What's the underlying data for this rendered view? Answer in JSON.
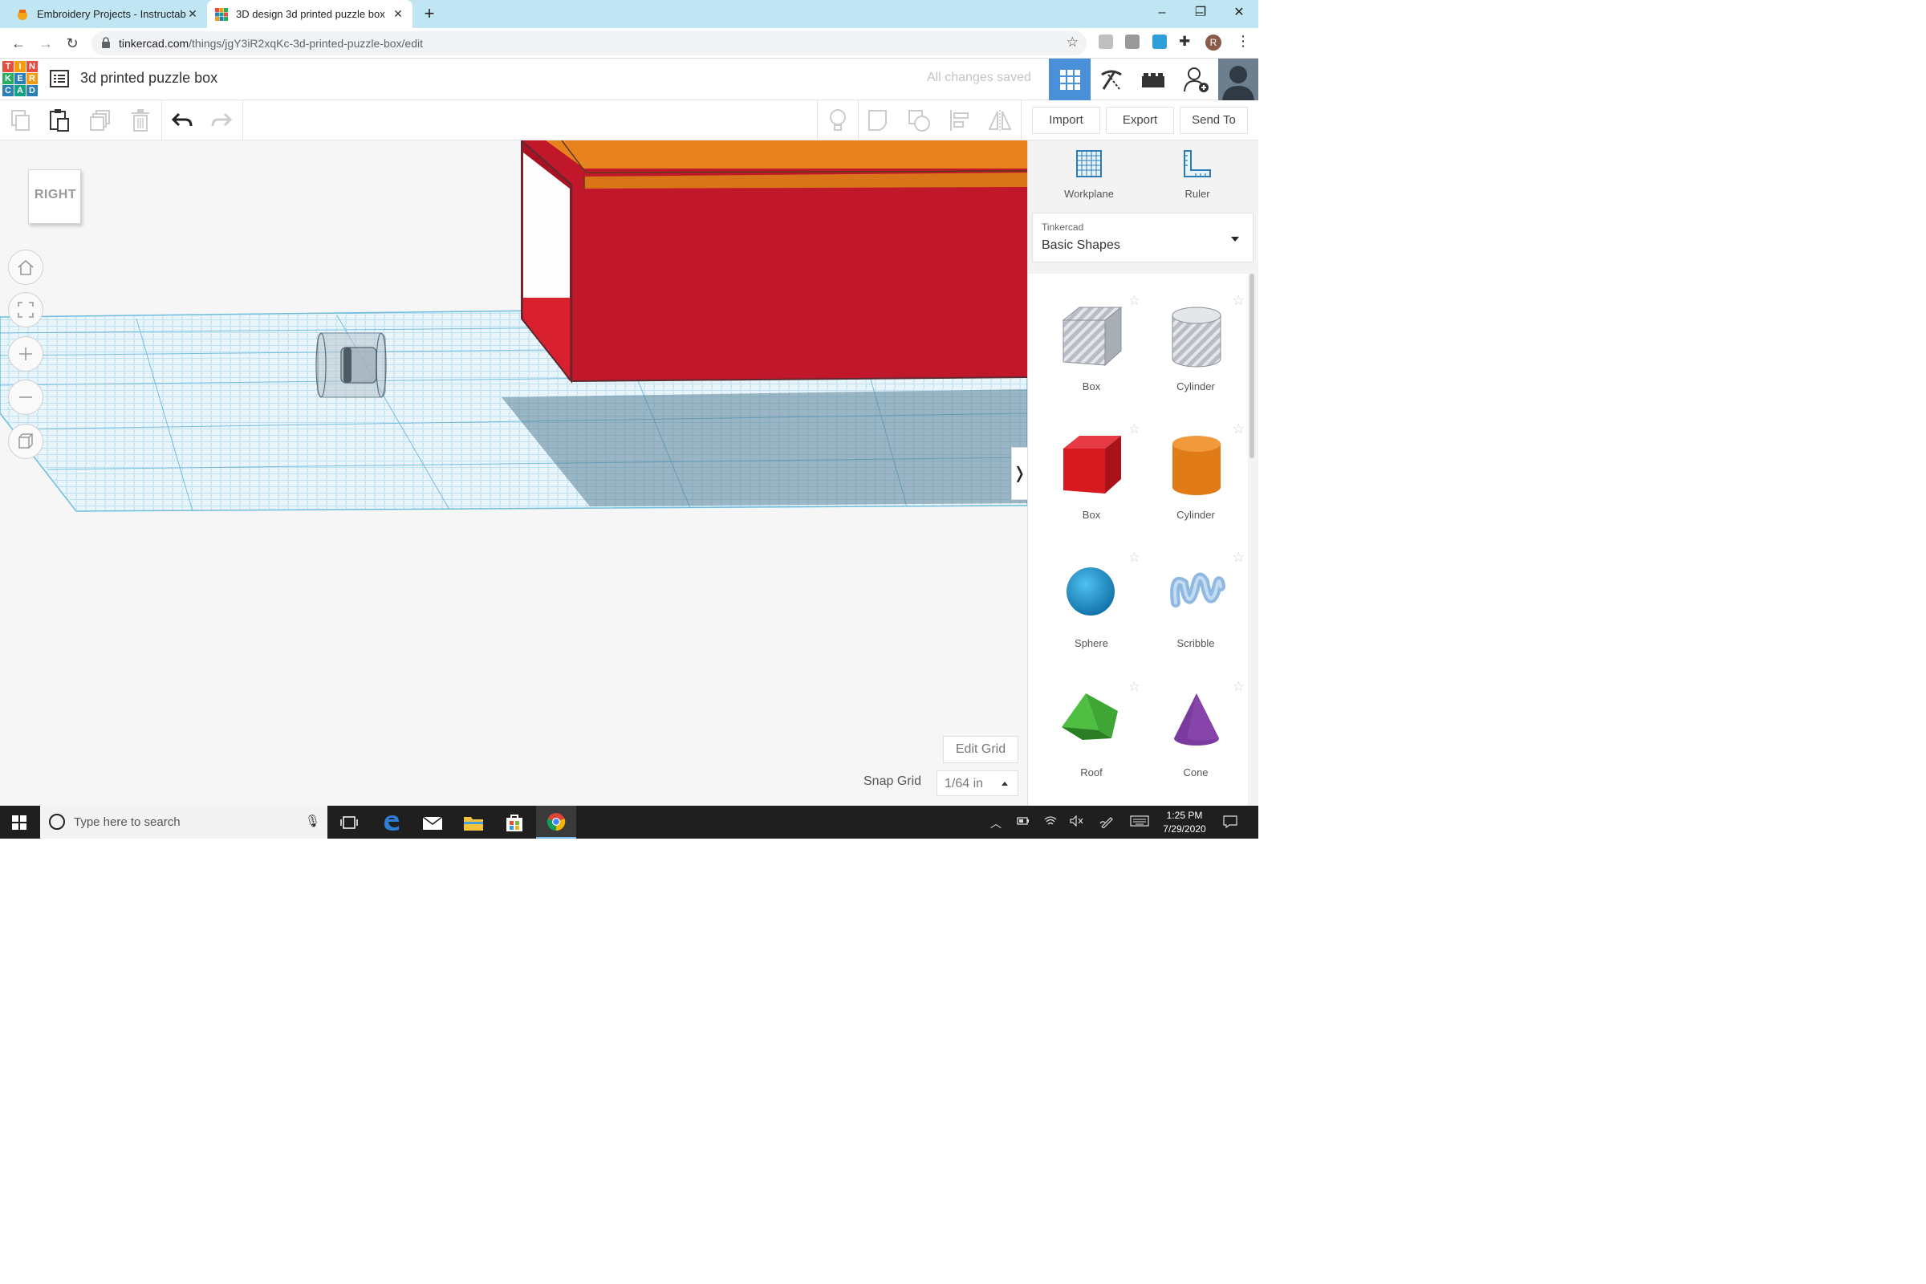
{
  "browser": {
    "tabs": [
      {
        "title": "Embroidery Projects - Instructabl",
        "active": false
      },
      {
        "title": "3D design 3d printed puzzle box",
        "active": true
      }
    ],
    "url_host": "tinkercad.com",
    "url_path": "/things/jgY3iR2xqKc-3d-printed-puzzle-box/edit",
    "profile_initial": "R"
  },
  "app": {
    "logo_letters": [
      "T",
      "I",
      "N",
      "K",
      "E",
      "R",
      "C",
      "A",
      "D"
    ],
    "design_title": "3d printed puzzle box",
    "save_status": "All changes saved"
  },
  "toolbar": {
    "import_label": "Import",
    "export_label": "Export",
    "send_to_label": "Send To"
  },
  "viewport": {
    "viewcube_face": "RIGHT",
    "edit_grid_label": "Edit Grid",
    "snap_grid_label": "Snap Grid",
    "snap_grid_value": "1/64 in"
  },
  "panel": {
    "tools": [
      {
        "label": "Workplane",
        "icon": "workplane-icon"
      },
      {
        "label": "Ruler",
        "icon": "ruler-icon"
      }
    ],
    "library_provider": "Tinkercad",
    "library_name": "Basic Shapes",
    "shapes": [
      {
        "label": "Box",
        "kind": "box-hole",
        "color": "#b8bcc4"
      },
      {
        "label": "Cylinder",
        "kind": "cylinder-hole",
        "color": "#b8bcc4"
      },
      {
        "label": "Box",
        "kind": "box",
        "color": "#d71920"
      },
      {
        "label": "Cylinder",
        "kind": "cylinder",
        "color": "#e07b18"
      },
      {
        "label": "Sphere",
        "kind": "sphere",
        "color": "#1a8ec9"
      },
      {
        "label": "Scribble",
        "kind": "scribble",
        "color": "#8fb9e0"
      },
      {
        "label": "Roof",
        "kind": "roof",
        "color": "#3fa535"
      },
      {
        "label": "Cone",
        "kind": "cone",
        "color": "#7b3a9e"
      }
    ]
  },
  "taskbar": {
    "search_placeholder": "Type here to search",
    "time": "1:25 PM",
    "date": "7/29/2020"
  },
  "colors": {
    "accent_blue": "#4a90d9",
    "object_red": "#c0182a",
    "object_orange": "#e8821e",
    "grid_blue": "#8fd0ea"
  }
}
